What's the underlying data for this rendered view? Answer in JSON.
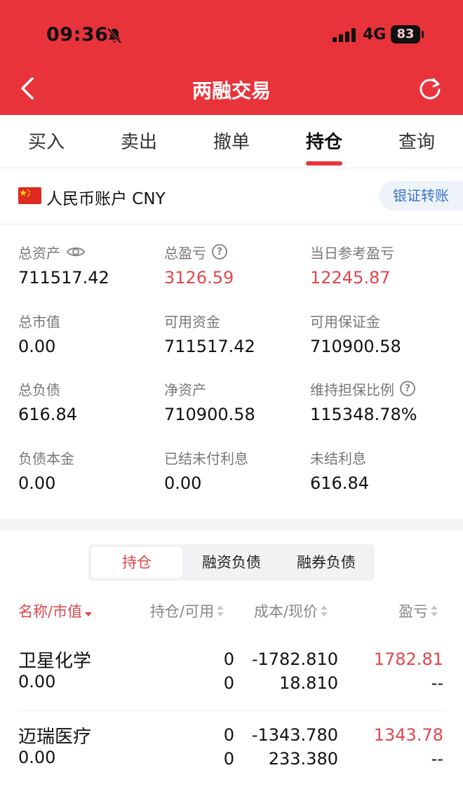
{
  "status_bar": {
    "time": "09:36",
    "network": "4G",
    "battery": "83"
  },
  "nav": {
    "title": "两融交易"
  },
  "tabs": [
    {
      "label": "买入"
    },
    {
      "label": "卖出"
    },
    {
      "label": "撤单"
    },
    {
      "label": "持仓",
      "active": true
    },
    {
      "label": "查询"
    }
  ],
  "account": {
    "label": "人民币账户 CNY",
    "transfer_label": "银证转账"
  },
  "stats": [
    {
      "label": "总资产",
      "value": "711517.42",
      "icon": "eye-icon"
    },
    {
      "label": "总盈亏",
      "value": "3126.59",
      "icon": "question-icon",
      "highlight": true
    },
    {
      "label": "当日参考盈亏",
      "value": "12245.87",
      "highlight": true
    },
    {
      "label": "总市值",
      "value": "0.00"
    },
    {
      "label": "可用资金",
      "value": "711517.42"
    },
    {
      "label": "可用保证金",
      "value": "710900.58"
    },
    {
      "label": "总负债",
      "value": "616.84"
    },
    {
      "label": "净资产",
      "value": "710900.58"
    },
    {
      "label": "维持担保比例",
      "value": "115348.78%",
      "icon": "question-icon"
    },
    {
      "label": "负债本金",
      "value": "0.00"
    },
    {
      "label": "已结未付利息",
      "value": "0.00"
    },
    {
      "label": "未结利息",
      "value": "616.84"
    }
  ],
  "segments": [
    {
      "label": "持仓",
      "active": true
    },
    {
      "label": "融资负债"
    },
    {
      "label": "融券负债"
    }
  ],
  "table": {
    "headers": [
      "名称/市值",
      "持仓/可用",
      "成本/现价",
      "盈亏"
    ],
    "rows": [
      {
        "name": "卫星化学",
        "market_value": "0.00",
        "position": "0",
        "available": "0",
        "cost": "-1782.810",
        "price": "18.810",
        "pnl": "1782.81",
        "pnl_sub": "--"
      },
      {
        "name": "迈瑞医疗",
        "market_value": "0.00",
        "position": "0",
        "available": "0",
        "cost": "-1343.780",
        "price": "233.380",
        "pnl": "1343.78",
        "pnl_sub": "--"
      }
    ]
  },
  "colors": {
    "brand_red": "#e8333a",
    "gain_red": "#e0474c",
    "link_blue": "#3a74c9"
  }
}
